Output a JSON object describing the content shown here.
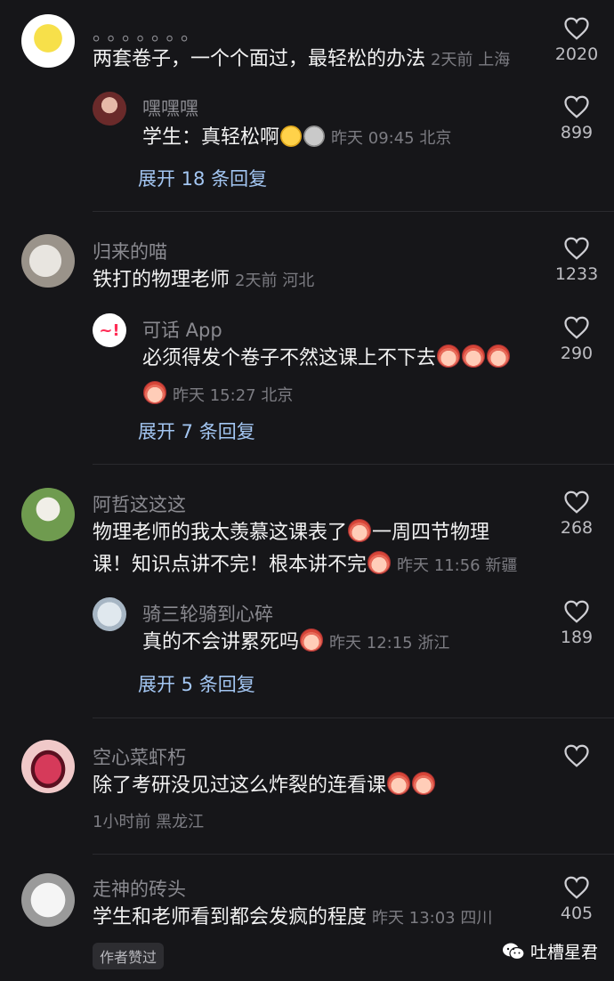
{
  "comments": [
    {
      "username": "。。。。。。。",
      "text": "两套卷子，一个个面过，最轻松的办法",
      "meta": "2天前 上海",
      "likes": "2020",
      "reply": {
        "username": "嘿嘿嘿",
        "text": "学生：真轻松啊",
        "meta": "昨天 09:45 北京",
        "likes": "899"
      },
      "expand": "展开 18 条回复"
    },
    {
      "username": "归来的喵",
      "text": "铁打的物理老师",
      "meta": "2天前 河北",
      "likes": "1233",
      "reply": {
        "username": "可话 App",
        "text": "必须得发个卷子不然这课上不下去",
        "meta": "昨天 15:27 北京",
        "likes": "290"
      },
      "expand": "展开 7 条回复"
    },
    {
      "username": "阿哲这这这",
      "text_line1": "物理老师的我太羡慕这课表了",
      "text_line1b": "一周四节物理",
      "text_line2": "课！知识点讲不完！根本讲不完",
      "meta": "昨天 11:56 新疆",
      "likes": "268",
      "reply": {
        "username": "骑三轮骑到心碎",
        "text": "真的不会讲累死吗",
        "meta": "昨天 12:15 浙江",
        "likes": "189"
      },
      "expand": "展开 5 条回复"
    },
    {
      "username": "空心菜虾朽",
      "text": "除了考研没见过这么炸裂的连看课",
      "meta": "1小时前 黑龙江"
    },
    {
      "username": "走神的砖头",
      "text": "学生和老师看到都会发疯的程度",
      "meta": "昨天 13:03 四川",
      "likes": "405",
      "badge": "作者赞过"
    }
  ],
  "watermark": "吐槽星君",
  "colors": {
    "background": "#161619",
    "expand": "#a3c6f2",
    "muted": "#7c7c82"
  }
}
